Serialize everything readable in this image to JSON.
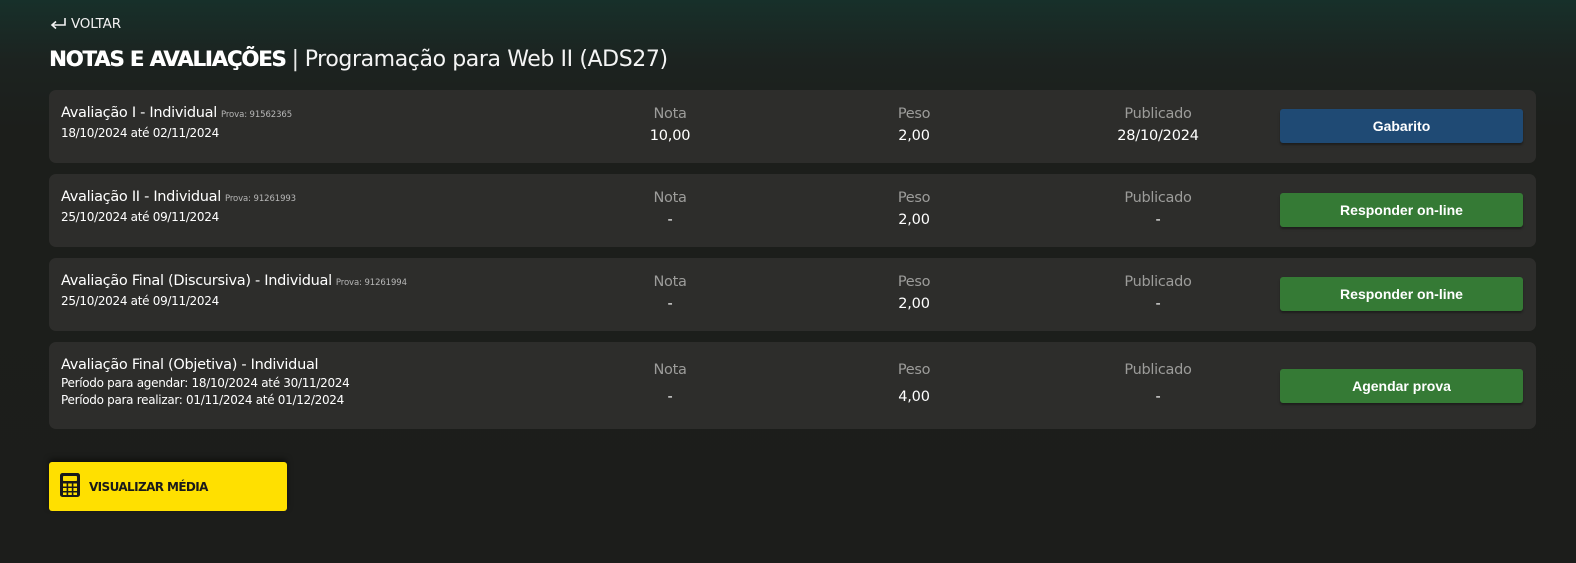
{
  "header": {
    "back_label": "VOLTAR",
    "title_main": "NOTAS E AVALIAÇÕES",
    "title_separator": "|",
    "title_sub": "Programação para Web II (ADS27)"
  },
  "columns": {
    "nota": "Nota",
    "peso": "Peso",
    "publicado": "Publicado"
  },
  "evaluations": [
    {
      "name": "Avaliação I - Individual",
      "code": "Prova: 91562365",
      "lines": [
        "18/10/2024 até 02/11/2024"
      ],
      "nota": "10,00",
      "peso": "2,00",
      "publicado": "28/10/2024",
      "action": "Gabarito",
      "action_color": "#1f4a74"
    },
    {
      "name": "Avaliação II - Individual",
      "code": "Prova: 91261993",
      "lines": [
        "25/10/2024 até 09/11/2024"
      ],
      "nota": "-",
      "peso": "2,00",
      "publicado": "-",
      "action": "Responder on-line",
      "action_color": "#357a35"
    },
    {
      "name": "Avaliação Final (Discursiva) - Individual",
      "code": "Prova: 91261994",
      "lines": [
        "25/10/2024 até 09/11/2024"
      ],
      "nota": "-",
      "peso": "2,00",
      "publicado": "-",
      "action": "Responder on-line",
      "action_color": "#357a35"
    },
    {
      "name": "Avaliação Final (Objetiva) - Individual",
      "code": "",
      "lines": [
        "Período para agendar: 18/10/2024 até 30/11/2024",
        "Período para realizar: 01/11/2024 até 01/12/2024"
      ],
      "nota": "-",
      "peso": "4,00",
      "publicado": "-",
      "action": "Agendar prova",
      "action_color": "#357a35"
    }
  ],
  "footer": {
    "media_label": "VISUALIZAR MÉDIA",
    "media_color": "#ffe000",
    "media_icon": "calculator-icon"
  },
  "colors": {
    "background": "#1c1d1b",
    "card": "#2d2d2b",
    "label_gray": "#9c9c9a"
  }
}
